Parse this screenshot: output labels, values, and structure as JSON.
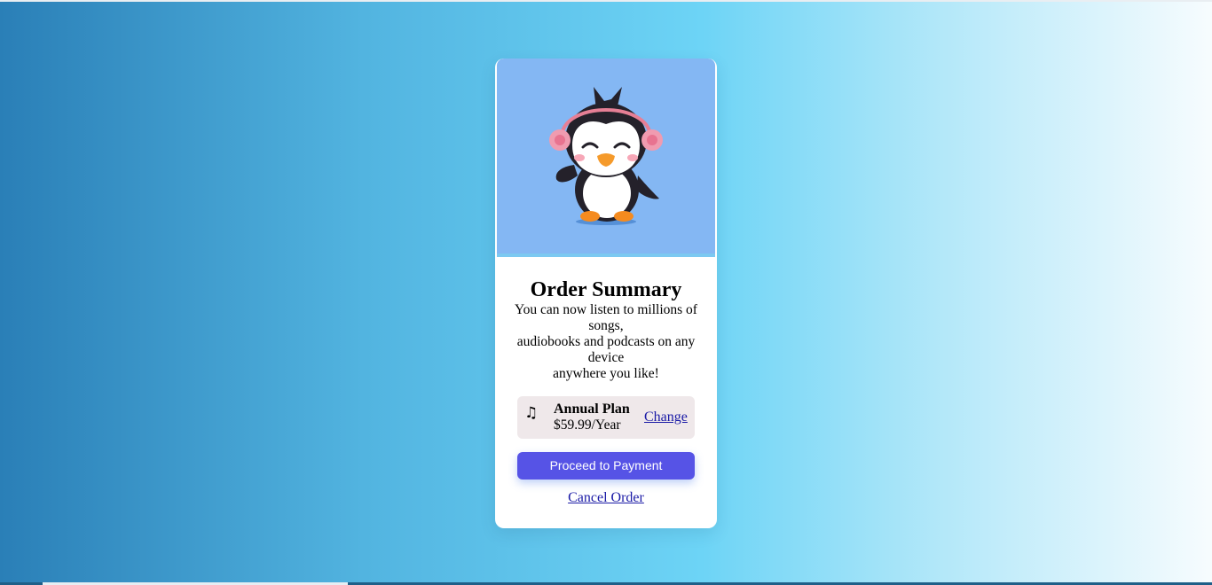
{
  "card": {
    "illustration": "penguin-with-headphones-icon",
    "title": "Order Summary",
    "description_lines": [
      "You can now listen to millions of songs,",
      "audiobooks and podcasts on any device",
      "anywhere you like!"
    ],
    "plan": {
      "icon": "♫",
      "icon_name": "music-note-icon",
      "name": "Annual Plan",
      "price": "$59.99/Year",
      "change_label": "Change"
    },
    "pay_label": "Proceed to Payment",
    "cancel_label": "Cancel Order"
  },
  "colors": {
    "accent": "#5653e6",
    "hero_background": "#84b7f3",
    "link": "#1a1aa6"
  }
}
